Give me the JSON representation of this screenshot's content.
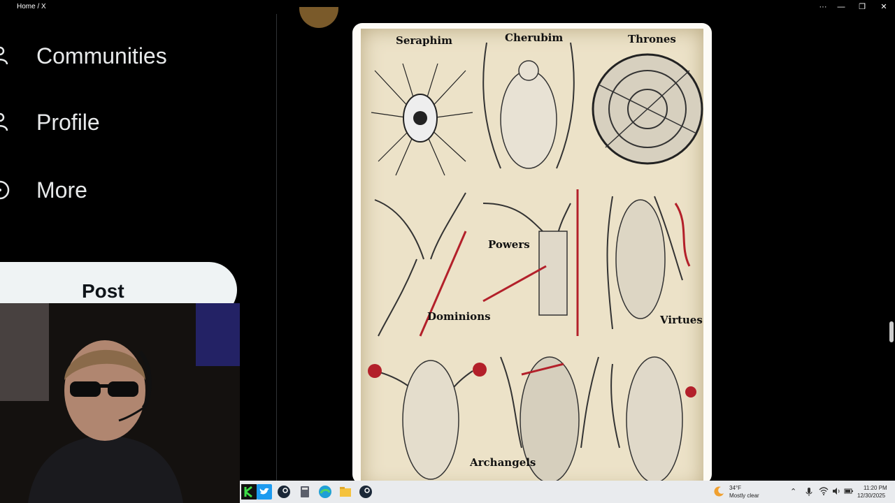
{
  "window": {
    "title": "Home / X"
  },
  "sidebar": {
    "items": [
      {
        "label": "Communities",
        "icon": "people-icon"
      },
      {
        "label": "Profile",
        "icon": "person-icon"
      },
      {
        "label": "More",
        "icon": "more-circle-icon"
      }
    ],
    "post_label": "Post"
  },
  "image": {
    "labels": [
      "Seraphim",
      "Cherubim",
      "Thrones",
      "Powers",
      "Dominions",
      "Virtues",
      "Archangels"
    ]
  },
  "taskbar": {
    "weather_temp": "34°F",
    "weather_desc": "Mostly clear",
    "time": "11:20 PM",
    "date": "12/30/2025"
  },
  "colors": {
    "background": "#000000",
    "post_button": "#eff3f4",
    "parchment": "#ece2c8",
    "accent_red": "#b3202a"
  }
}
